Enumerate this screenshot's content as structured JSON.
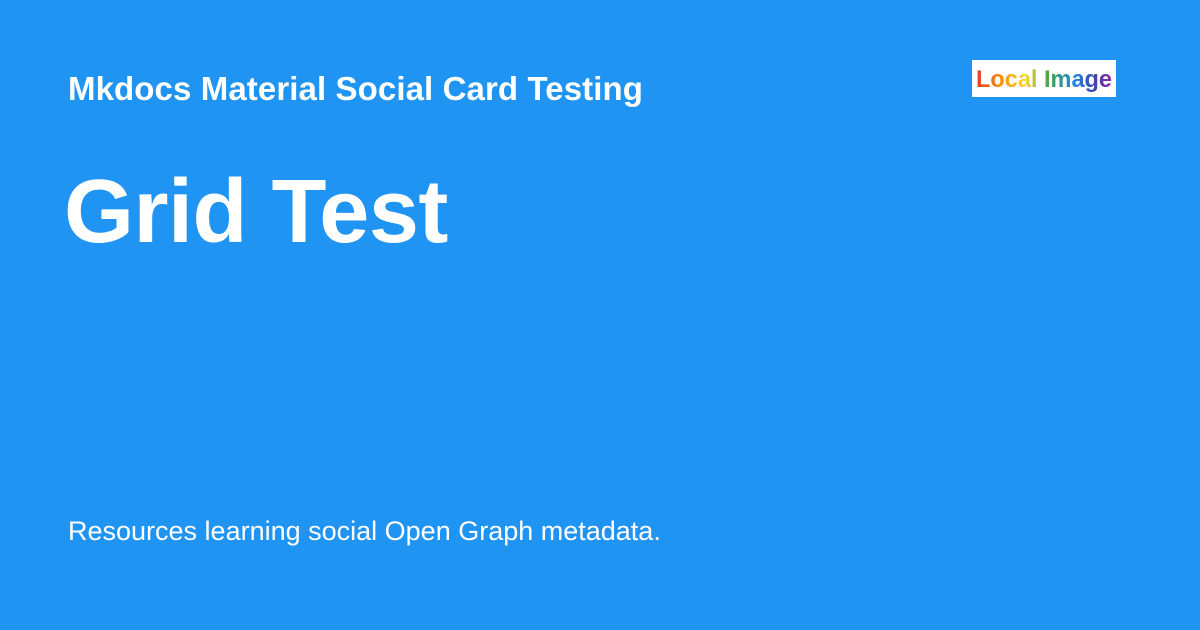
{
  "card": {
    "site_name": "Mkdocs Material Social Card Testing",
    "page_title": "Grid Test",
    "description": "Resources learning social Open Graph metadata.",
    "background_color": "#2094f3",
    "text_color": "#ffffff"
  },
  "logo": {
    "text": "Local Image",
    "background_color": "#ffffff",
    "letter_colors": [
      "#e53935",
      "#fb8c00",
      "#fdd835",
      "#43a047",
      "#1e88e5",
      "#3949ab",
      "#8e24aa"
    ]
  }
}
